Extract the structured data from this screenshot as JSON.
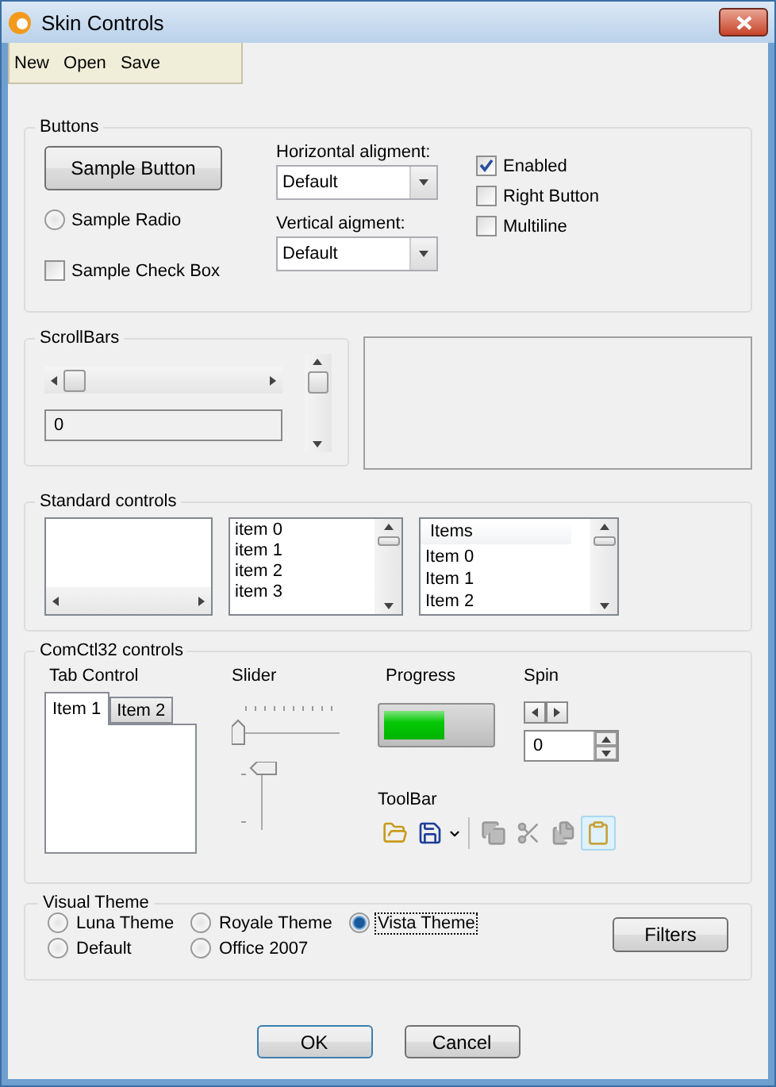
{
  "window": {
    "title": "Skin Controls"
  },
  "menu": [
    "New",
    "Open",
    "Save"
  ],
  "buttons_group": {
    "title": "Buttons",
    "sample_button": "Sample Button",
    "sample_radio": {
      "label": "Sample Radio",
      "selected": false
    },
    "sample_check": {
      "label": "Sample Check Box",
      "checked": false
    },
    "horizontal": {
      "label": "Horizontal aligment:",
      "value": "Default"
    },
    "vertical": {
      "label": "Vertical aigment:",
      "value": "Default"
    },
    "options": [
      {
        "label": "Enabled",
        "checked": true
      },
      {
        "label": "Right Button",
        "checked": false
      },
      {
        "label": "Multiline",
        "checked": false
      }
    ]
  },
  "scrollbars": {
    "title": "ScrollBars",
    "value": "0"
  },
  "standard": {
    "title": "Standard controls",
    "list": [
      "item 0",
      "item 1",
      "item 2",
      "item 3"
    ],
    "listview": {
      "header": "Items",
      "rows": [
        "Item 0",
        "Item 1",
        "Item 2"
      ]
    }
  },
  "comctl": {
    "title": "ComCtl32 controls",
    "tab_control": {
      "label": "Tab Control",
      "tabs": [
        {
          "label": "Item 1",
          "selected": true
        },
        {
          "label": "Item 2",
          "selected": false
        }
      ]
    },
    "slider": {
      "label": "Slider",
      "horizontal": {
        "level": 0
      },
      "vertical": {
        "level": 1
      }
    },
    "progress": {
      "label": "Progress",
      "level": 0.58
    },
    "spin": {
      "label": "Spin",
      "value": "0"
    },
    "toolbar": {
      "label": "ToolBar",
      "buttons": [
        {
          "disabled": false,
          "pressed": false
        },
        {
          "disabled": false,
          "pressed": false
        },
        {
          "disabled": true,
          "pressed": false
        },
        {
          "disabled": true,
          "pressed": false
        },
        {
          "disabled": true,
          "pressed": false
        },
        {
          "disabled": false,
          "pressed": true
        }
      ]
    }
  },
  "theme": {
    "title": "Visual Theme",
    "options": [
      {
        "label": "Luna Theme",
        "selected": false
      },
      {
        "label": "Default",
        "selected": false
      },
      {
        "label": "Royale Theme",
        "selected": false
      },
      {
        "label": "Office 2007",
        "selected": false
      },
      {
        "label": "Vista Theme",
        "selected": true
      }
    ],
    "filters": "Filters"
  },
  "footer": [
    "OK",
    "Cancel"
  ]
}
